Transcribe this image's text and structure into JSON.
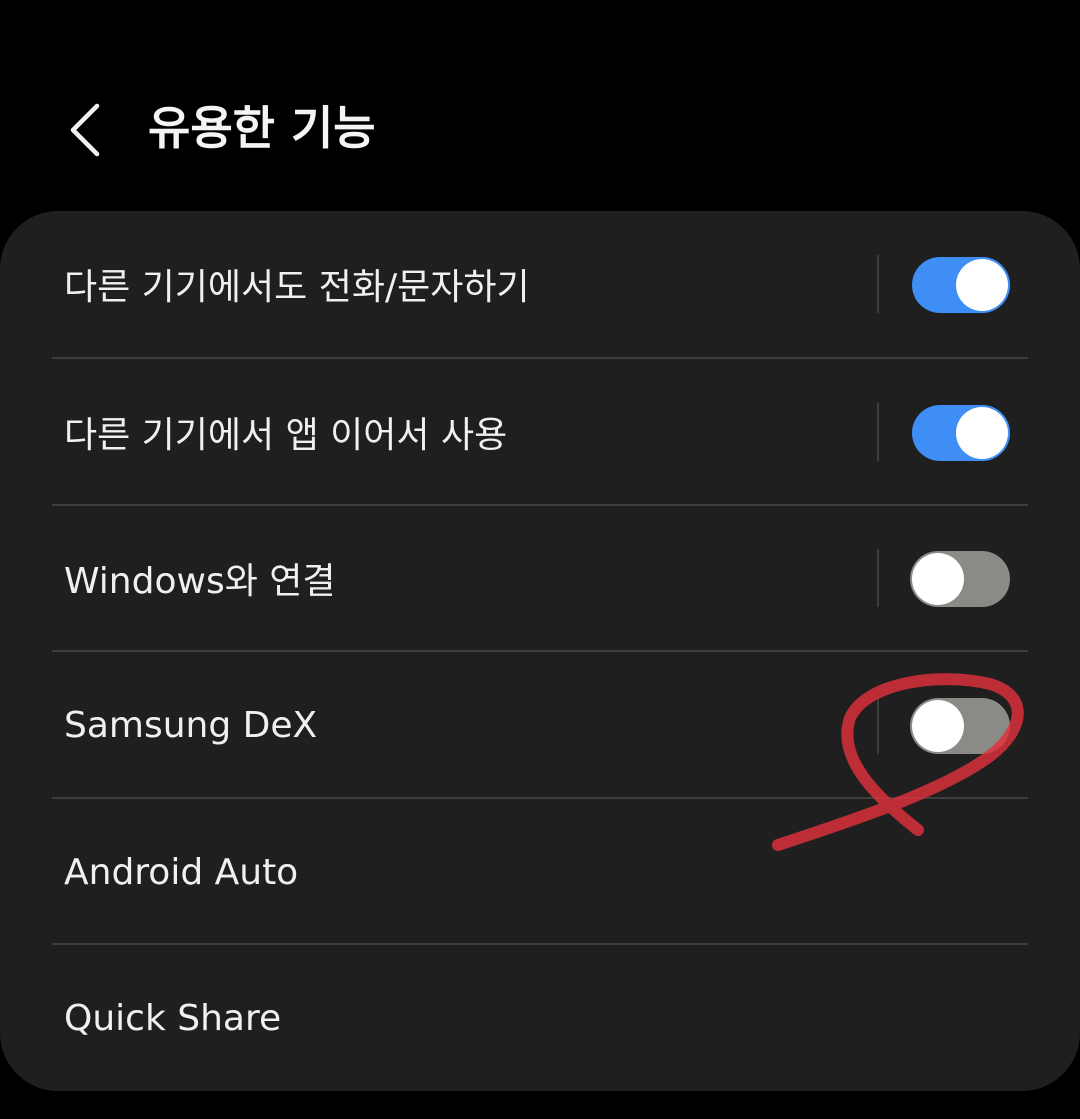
{
  "header": {
    "title": "유용한 기능",
    "back_icon": "chevron-left-icon"
  },
  "settings": [
    {
      "label": "다른 기기에서도 전화/문자하기",
      "toggle": "on"
    },
    {
      "label": "다른 기기에서 앱 이어서 사용",
      "toggle": "on"
    },
    {
      "label": "Windows와 연결",
      "toggle": "off"
    },
    {
      "label": "Samsung DeX",
      "toggle": "off"
    },
    {
      "label": "Android Auto",
      "toggle": null
    },
    {
      "label": "Quick Share",
      "toggle": null
    }
  ],
  "colors": {
    "background": "#000000",
    "card": "#1f1f1f",
    "toggle_on": "#3e8ef5",
    "toggle_off": "#8a8a86",
    "annotation_mark": "#e0313a"
  }
}
